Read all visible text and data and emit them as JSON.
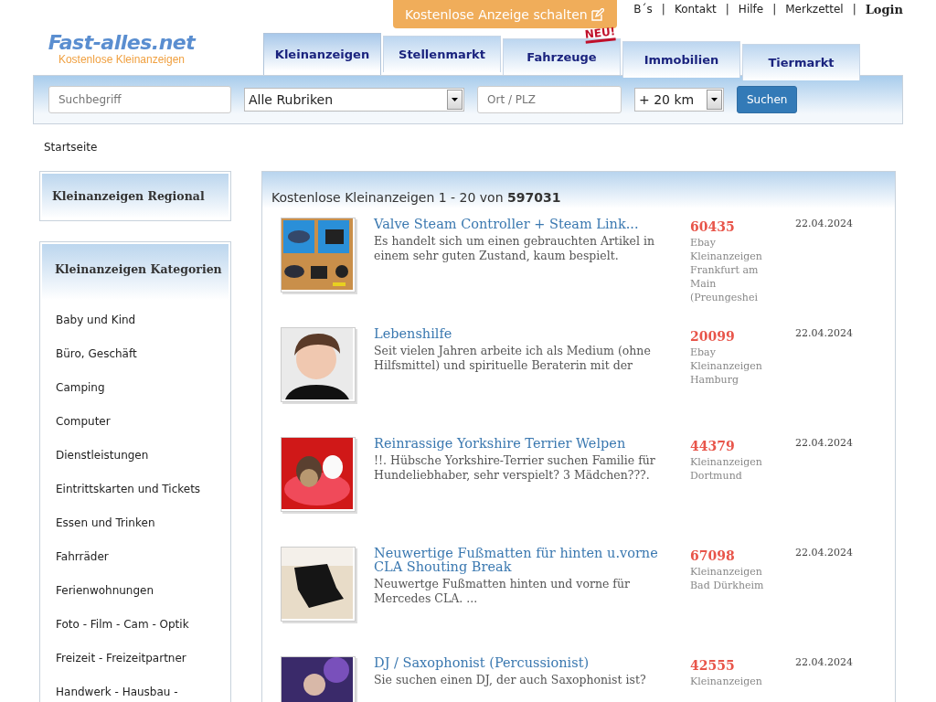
{
  "cta_button": {
    "label": "Kostenlose Anzeige schalten"
  },
  "top_links": [
    "B´s",
    "Kontakt",
    "Hilfe",
    "Merkzettel",
    "Login"
  ],
  "link_separator": "|",
  "logo": {
    "name": "Fast-alles.net",
    "tagline": "Kostenlose Kleinanzeigen"
  },
  "tabs": [
    {
      "label": "Kleinanzeigen",
      "selected": true
    },
    {
      "label": "Stellenmarkt",
      "selected": false
    },
    {
      "label": "Fahrzeuge",
      "selected": false,
      "badge": "NEU!"
    },
    {
      "label": "Immobilien",
      "selected": false
    },
    {
      "label": "Tiermarkt",
      "selected": false
    }
  ],
  "search": {
    "query_placeholder": "Suchbegriff",
    "category": "Alle Rubriken",
    "location_placeholder": "Ort / PLZ",
    "radius": "+ 20 km",
    "button": "Suchen"
  },
  "breadcrumb": "Startseite",
  "sidebar": {
    "regional_title": "Kleinanzeigen Regional",
    "categories_title": "Kleinanzeigen Kategorien",
    "categories": [
      "Baby und Kind",
      "Büro, Geschäft",
      "Camping",
      "Computer",
      "Dienstleistungen",
      "Eintrittskarten und Tickets",
      "Essen und Trinken",
      "Fahrräder",
      "Ferienwohnungen",
      "Foto - Film - Cam - Optik",
      "Freizeit - Freizeitpartner",
      "Handwerk - Hausbau -"
    ]
  },
  "listing": {
    "heading": "Kostenlose Kleinanzeigen 1 - 20 von **597031**",
    "ads": [
      {
        "title": "Valve Steam Controller + Steam Link...",
        "description": "Es handelt sich um einen gebrauchten Artikel in einem sehr guten Zustand, kaum bespielt.",
        "zip": "60435",
        "location": "Ebay Kleinanzeigen Frankfurt am Main (Preungeshei",
        "date": "22.04.2024"
      },
      {
        "title": "Lebenshilfe",
        "description": "Seit vielen Jahren arbeite ich als Medium (ohne Hilfsmittel) und spirituelle Beraterin mit der",
        "zip": "20099",
        "location": "Ebay Kleinanzeigen Hamburg",
        "date": "22.04.2024"
      },
      {
        "title": "Reinrassige Yorkshire Terrier Welpen",
        "description": "!!. Hübsche Yorkshire-Terrier suchen Familie für Hundeliebhaber, sehr verspielt? 3 Mädchen???.",
        "zip": "44379",
        "location": "Kleinanzeigen Dortmund",
        "date": "22.04.2024"
      },
      {
        "title": "Neuwertige Fußmatten für hinten u.vorne CLA Shouting Break",
        "description": "Neuwertge Fußmatten hinten und vorne für Mercedes CLA. ...",
        "zip": "67098",
        "location": "Kleinanzeigen Bad Dürkheim",
        "date": "22.04.2024"
      },
      {
        "title": "DJ / Saxophonist (Percussionist)",
        "description": "Sie suchen einen DJ, der auch Saxophonist ist?",
        "zip": "42555",
        "location": "Kleinanzeigen",
        "date": "22.04.2024"
      }
    ]
  }
}
